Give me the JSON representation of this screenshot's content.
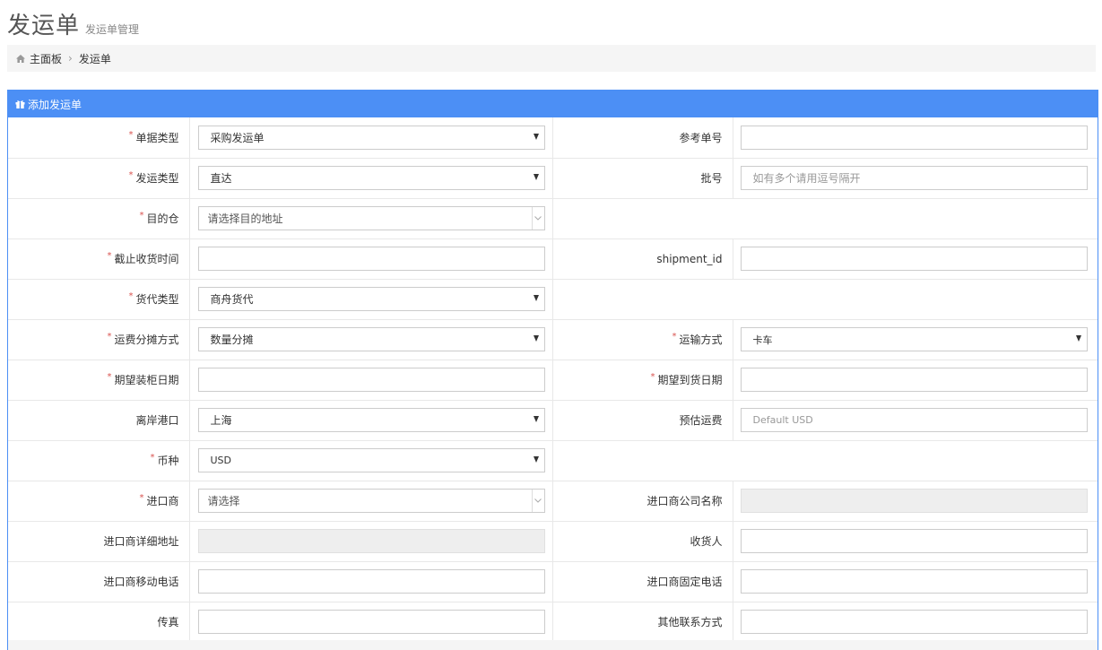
{
  "header": {
    "title": "发运单",
    "subtitle": "发运单管理"
  },
  "breadcrumb": {
    "home": "主面板",
    "current": "发运单",
    "separator": "›"
  },
  "panel": {
    "title": "添加发运单"
  },
  "form": {
    "doc_type": {
      "label": "单据类型",
      "value": "采购发运单"
    },
    "ref_no": {
      "label": "参考单号",
      "value": ""
    },
    "ship_type": {
      "label": "发运类型",
      "value": "直达"
    },
    "batch_no": {
      "label": "批号",
      "placeholder": "如有多个请用逗号隔开"
    },
    "dest_warehouse": {
      "label": "目的仓",
      "placeholder": "请选择目的地址"
    },
    "cutoff_time": {
      "label": "截止收货时间",
      "value": ""
    },
    "shipment_id": {
      "label": "shipment_id",
      "value": ""
    },
    "forwarder_type": {
      "label": "货代类型",
      "value": "商舟货代"
    },
    "freight_alloc": {
      "label": "运费分摊方式",
      "value": "数量分摊"
    },
    "transport_mode": {
      "label": "运输方式",
      "value": "卡车"
    },
    "expected_load_date": {
      "label": "期望装柜日期",
      "value": ""
    },
    "expected_arrival_date": {
      "label": "期望到货日期",
      "value": ""
    },
    "departure_port": {
      "label": "离岸港口",
      "value": "上海"
    },
    "est_freight": {
      "label": "预估运费",
      "placeholder": "Default USD"
    },
    "currency": {
      "label": "币种",
      "value": "USD"
    },
    "importer": {
      "label": "进口商",
      "placeholder": "请选择"
    },
    "importer_company": {
      "label": "进口商公司名称",
      "value": ""
    },
    "importer_address": {
      "label": "进口商详细地址",
      "value": ""
    },
    "consignee": {
      "label": "收货人",
      "value": ""
    },
    "importer_mobile": {
      "label": "进口商移动电话",
      "value": ""
    },
    "importer_phone": {
      "label": "进口商固定电话",
      "value": ""
    },
    "fax": {
      "label": "传真",
      "value": ""
    },
    "other_contact": {
      "label": "其他联系方式",
      "value": ""
    }
  },
  "required_mark": "*",
  "colors": {
    "panel_blue": "#4c8ff5",
    "required_red": "#d9534f",
    "disabled_bg": "#eeeeee"
  },
  "icons": {
    "breadcrumb": "home-icon",
    "panel": "gift-icon",
    "select": "caret-down-icon",
    "select2": "chevron-down-icon"
  }
}
